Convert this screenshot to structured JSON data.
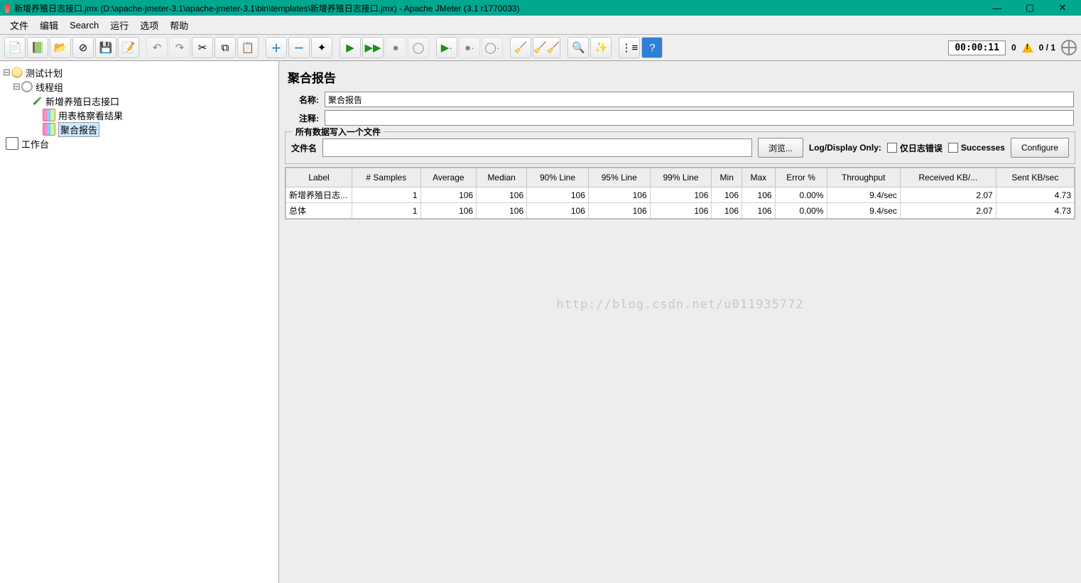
{
  "titlebar": {
    "text": "新增养殖日志接口.jmx (D:\\apache-jmeter-3.1\\apache-jmeter-3.1\\bin\\templates\\新增养殖日志接口.jmx) - Apache JMeter (3.1 r1770033)"
  },
  "menu": {
    "file": "文件",
    "edit": "编辑",
    "search": "Search",
    "run": "运行",
    "options": "选项",
    "help": "帮助"
  },
  "toolbar": {
    "timer": "00:00:11",
    "warn_count": "0",
    "thread_count": "0 / 1"
  },
  "tree": {
    "plan": "测试计划",
    "thread_group": "线程组",
    "sampler": "新增养殖日志接口",
    "listener_table": "用表格察看结果",
    "listener_agg": "聚合报告",
    "workbench": "工作台"
  },
  "panel": {
    "title": "聚合报告",
    "name_label": "名称:",
    "name_value": "聚合报告",
    "comment_label": "注释:",
    "comment_value": "",
    "file_legend": "所有数据写入一个文件",
    "file_label": "文件名",
    "file_value": "",
    "browse": "浏览...",
    "log_only": "Log/Display Only:",
    "errors_only": "仅日志错误",
    "successes": "Successes",
    "configure": "Configure"
  },
  "table": {
    "headers": [
      "Label",
      "# Samples",
      "Average",
      "Median",
      "90% Line",
      "95% Line",
      "99% Line",
      "Min",
      "Max",
      "Error %",
      "Throughput",
      "Received KB/...",
      "Sent KB/sec"
    ],
    "rows": [
      {
        "label": "新增养殖日志...",
        "samples": "1",
        "avg": "106",
        "median": "106",
        "p90": "106",
        "p95": "106",
        "p99": "106",
        "min": "106",
        "max": "106",
        "err": "0.00%",
        "tput": "9.4/sec",
        "recv": "2.07",
        "sent": "4.73"
      },
      {
        "label": "总体",
        "samples": "1",
        "avg": "106",
        "median": "106",
        "p90": "106",
        "p95": "106",
        "p99": "106",
        "min": "106",
        "max": "106",
        "err": "0.00%",
        "tput": "9.4/sec",
        "recv": "2.07",
        "sent": "4.73"
      }
    ]
  },
  "watermark": "http://blog.csdn.net/u011935772"
}
